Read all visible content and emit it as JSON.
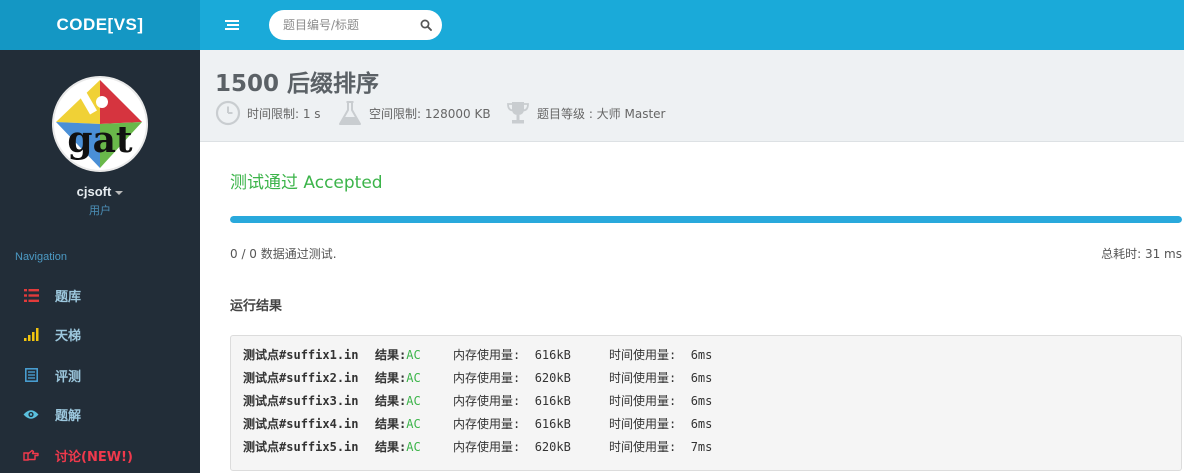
{
  "brand": "CODE[VS]",
  "search": {
    "placeholder": "题目编号/标题"
  },
  "user": {
    "name": "cjsoft",
    "role": "用户",
    "avatar_text": "gat"
  },
  "nav": {
    "heading": "Navigation",
    "items": [
      {
        "label": "题库",
        "icon": "list-icon",
        "color": "#e23b3b"
      },
      {
        "label": "天梯",
        "icon": "signal-bars-icon",
        "color": "#f1c40f"
      },
      {
        "label": "评测",
        "icon": "document-icon",
        "color": "#4aa3d8"
      },
      {
        "label": "题解",
        "icon": "eye-icon",
        "color": "#5bc0de"
      },
      {
        "label": "讨论(NEW!)",
        "icon": "hand-pointer-icon",
        "color": "#f0394c"
      }
    ]
  },
  "problem": {
    "title": "1500 后缀排序",
    "time_limit": "时间限制: 1 s",
    "memory_limit": "空间限制: 128000 KB",
    "level": "题目等级 : 大师 Master"
  },
  "judge": {
    "status": "测试通过 Accepted",
    "progress_fraction": 1.0,
    "summary": "0 / 0 数据通过测试.",
    "total_time": "总耗时: 31 ms"
  },
  "results": {
    "heading": "运行结果",
    "rows": [
      {
        "point_label": "测试点",
        "point": "#suffix1.in",
        "result_label": "结果:",
        "result": "AC",
        "mem_label": "内存使用量:",
        "mem": "616kB",
        "time_label": "时间使用量:",
        "time": "6ms"
      },
      {
        "point_label": "测试点",
        "point": "#suffix2.in",
        "result_label": "结果:",
        "result": "AC",
        "mem_label": "内存使用量:",
        "mem": "620kB",
        "time_label": "时间使用量:",
        "time": "6ms"
      },
      {
        "point_label": "测试点",
        "point": "#suffix3.in",
        "result_label": "结果:",
        "result": "AC",
        "mem_label": "内存使用量:",
        "mem": "616kB",
        "time_label": "时间使用量:",
        "time": "6ms"
      },
      {
        "point_label": "测试点",
        "point": "#suffix4.in",
        "result_label": "结果:",
        "result": "AC",
        "mem_label": "内存使用量:",
        "mem": "616kB",
        "time_label": "时间使用量:",
        "time": "6ms"
      },
      {
        "point_label": "测试点",
        "point": "#suffix5.in",
        "result_label": "结果:",
        "result": "AC",
        "mem_label": "内存使用量:",
        "mem": "620kB",
        "time_label": "时间使用量:",
        "time": "7ms"
      }
    ]
  }
}
